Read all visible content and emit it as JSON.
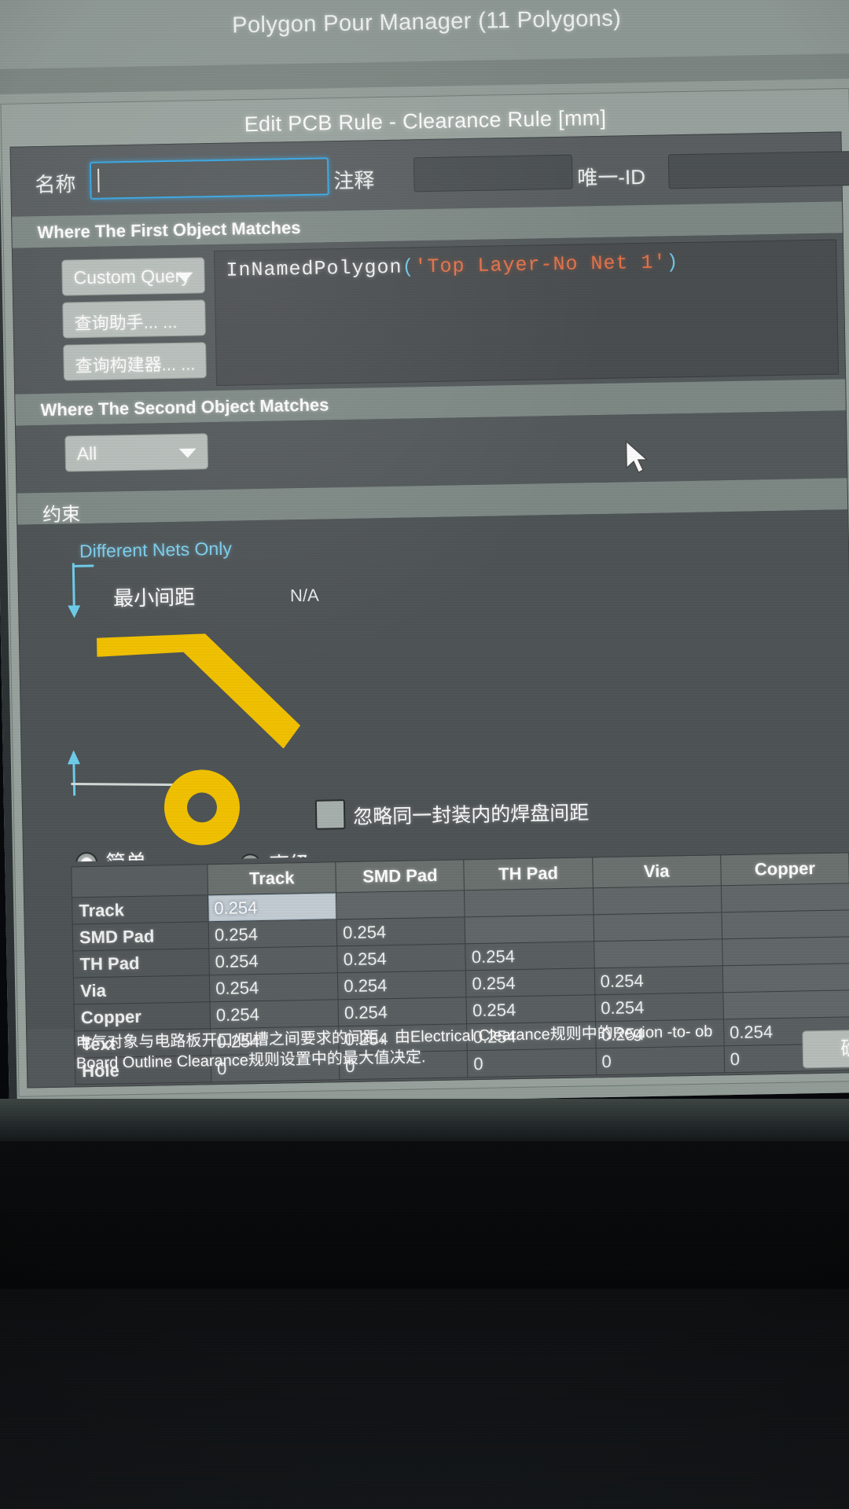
{
  "app": {
    "window_title": "Polygon Pour Manager (11 Polygons)"
  },
  "dialog": {
    "title": "Edit PCB Rule - Clearance Rule [mm]",
    "name_label": "名称",
    "name_value": "",
    "comment_label": "注释",
    "comment_value": "",
    "unique_id_label": "唯一-ID",
    "unique_id_value": ""
  },
  "first_object": {
    "section_title": "Where The First Object Matches",
    "scope_select": "Custom Query",
    "query_helper_button": "查询助手... ...",
    "query_builder_button": "查询构建器... ...",
    "query_expression": {
      "full": "InNamedPolygon('Top Layer-No Net 1')",
      "function": "InNamedPolygon",
      "open_paren": "(",
      "argument": "'Top Layer-No Net 1'",
      "close_paren": ")"
    }
  },
  "second_object": {
    "section_title": "Where The Second Object Matches",
    "scope_select": "All"
  },
  "constraints": {
    "section_title": "约束",
    "different_nets_only": "Different Nets Only",
    "min_clearance_label": "最小间距",
    "min_clearance_value": "N/A",
    "ignore_pad_checkbox_label": "忽略同一封装内的焊盘间距",
    "ignore_pad_checked": false,
    "mode_simple": "简单",
    "mode_advanced": "高级",
    "mode_selected": "简单"
  },
  "matrix": {
    "columns": [
      "",
      "Track",
      "SMD Pad",
      "TH Pad",
      "Via",
      "Copper"
    ],
    "rows": [
      {
        "label": "Track",
        "values": [
          "0.254",
          "",
          "",
          "",
          ""
        ],
        "selected_col": 0
      },
      {
        "label": "SMD Pad",
        "values": [
          "0.254",
          "0.254",
          "",
          "",
          ""
        ]
      },
      {
        "label": "TH Pad",
        "values": [
          "0.254",
          "0.254",
          "0.254",
          "",
          ""
        ]
      },
      {
        "label": "Via",
        "values": [
          "0.254",
          "0.254",
          "0.254",
          "0.254",
          ""
        ]
      },
      {
        "label": "Copper",
        "values": [
          "0.254",
          "0.254",
          "0.254",
          "0.254",
          ""
        ]
      },
      {
        "label": "Text",
        "values": [
          "0.254",
          "0.254",
          "0.254",
          "0.254",
          "0.254"
        ]
      },
      {
        "label": "Hole",
        "values": [
          "0",
          "0",
          "0",
          "0",
          "0"
        ]
      }
    ]
  },
  "footer": {
    "note_line1": "电气对象与电路板开口/凹槽之间要求的间距，由Electrical Clearance规则中的Region -to- ob",
    "note_line2": "Board Outline Clearance规则设置中的最大值决定."
  },
  "buttons": {
    "ok": "确"
  },
  "colors": {
    "accent_focus": "#35a8e8",
    "link_cyan": "#7fd2ef",
    "copper_yellow": "#f5c400",
    "query_string": "#e8744a"
  }
}
